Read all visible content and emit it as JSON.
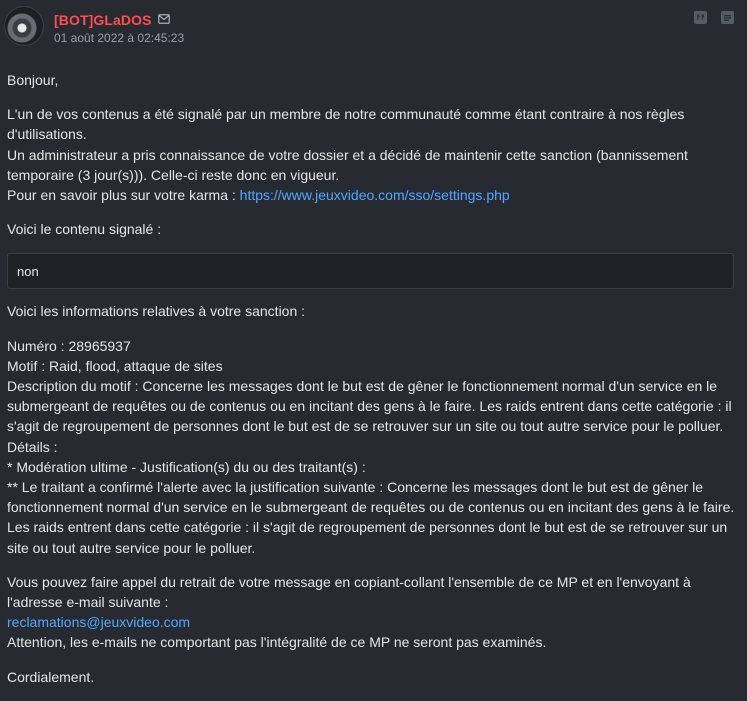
{
  "post": {
    "author": "[BOT]GLaDOS",
    "date": "01 août 2022 à 02:45:23",
    "icons": {
      "avatar": "avatar",
      "mail": "mail-icon",
      "quote": "quote-icon",
      "more": "more-icon"
    },
    "colors": {
      "background": "#272a31",
      "author": "#ff4f4f",
      "link": "#53a7ff"
    }
  },
  "message": {
    "greeting": "Bonjour,",
    "para1_line1": "L'un de vos contenus a été signalé par un membre de notre communauté comme étant contraire à nos règles d'utilisations.",
    "para1_line2": "Un administrateur a pris connaissance de votre dossier et a décidé de maintenir cette sanction (bannissement temporaire (3 jour(s))). Celle-ci reste donc en vigueur.",
    "karma_prefix": "Pour en savoir plus sur votre karma : ",
    "karma_link": "https://www.jeuxvideo.com/sso/settings.php",
    "reported_label": "Voici le contenu signalé :",
    "reported_content": "non",
    "sanction_label": "Voici les informations relatives à votre sanction :",
    "numero": "Numéro : 28965937",
    "motif": "Motif : Raid, flood, attaque de sites",
    "description": "Description du motif : Concerne les messages dont le but est de gêner le fonctionnement normal d'un service en le submergeant de requêtes ou de contenus ou en incitant des gens à le faire. Les raids entrent dans cette catégorie : il s'agit de regroupement de personnes dont le but est de se retrouver sur un site ou tout autre service pour le polluer.",
    "details": "Détails :",
    "moderation": "* Modération ultime - Justification(s) du ou des traitant(s) :",
    "traitant": "** Le traitant a confirmé l'alerte avec la justification suivante : Concerne les messages dont le but est de gêner le fonctionnement normal d'un service en le submergeant de requêtes ou de contenus ou en incitant des gens à le faire. Les raids entrent dans cette catégorie : il s'agit de regroupement de personnes dont le but est de se retrouver sur un site ou tout autre service pour le polluer.",
    "appeal_line1": "Vous pouvez faire appel du retrait de votre message en copiant-collant l'ensemble de ce MP et en l'envoyant à l'adresse e-mail suivante :",
    "appeal_email": "reclamations@jeuxvideo.com",
    "appeal_line3": "Attention, les e-mails ne comportant pas l'intégralité de ce MP ne seront pas examinés.",
    "closing": "Cordialement."
  }
}
